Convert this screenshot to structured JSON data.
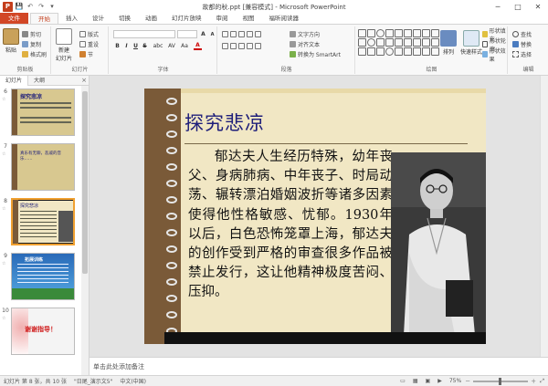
{
  "window": {
    "title": "故都的秋.ppt [兼容模式] - Microsoft PowerPoint",
    "logo_letter": "P",
    "minimize": "─",
    "maximize": "□",
    "close": "✕"
  },
  "quick_access": {
    "save": "💾",
    "undo": "↶",
    "redo": "↷",
    "more": "▾"
  },
  "tabs": [
    {
      "label": "文件"
    },
    {
      "label": "开始"
    },
    {
      "label": "插入"
    },
    {
      "label": "设计"
    },
    {
      "label": "切换"
    },
    {
      "label": "动画"
    },
    {
      "label": "幻灯片放映"
    },
    {
      "label": "审阅"
    },
    {
      "label": "视图"
    },
    {
      "label": "福昕阅读器"
    }
  ],
  "ribbon": {
    "clipboard": {
      "label": "剪贴板",
      "paste": "粘贴",
      "cut": "剪切",
      "copy": "复制",
      "format_painter": "格式刷"
    },
    "slides": {
      "label": "幻灯片",
      "new_slide": "新建",
      "new_slide_2": "幻灯片",
      "layout": "版式",
      "reset": "重设",
      "section": "节"
    },
    "font": {
      "label": "字体",
      "bold": "B",
      "italic": "I",
      "underline": "U",
      "strike": "S",
      "shadow": "abc",
      "spacing": "AV",
      "case": "Aa",
      "color": "A"
    },
    "paragraph": {
      "label": "段落",
      "text_direction": "文字方向",
      "align_text": "对齐文本",
      "smartart": "转换为 SmartArt"
    },
    "drawing": {
      "label": "绘图",
      "arrange": "排列",
      "quick_styles": "快速样式",
      "shape_fill": "形状填充",
      "shape_outline": "形状轮廓",
      "shape_effects": "形状效果"
    },
    "editing": {
      "label": "编辑",
      "find": "查找",
      "replace": "替换",
      "select": "选择"
    }
  },
  "left_panel": {
    "tab_slides": "幻灯片",
    "tab_outline": "大纲",
    "close": "×",
    "thumbnails": [
      {
        "num": "6",
        "title": "探究悲凉"
      },
      {
        "num": "7",
        "text": "真乐有无聊，悲戚的音乐……"
      },
      {
        "num": "8",
        "title": "探究悲凉"
      },
      {
        "num": "9",
        "title": "拓展训练"
      },
      {
        "num": "10",
        "title": "谢谢指导！"
      }
    ]
  },
  "slide": {
    "title": "探究悲凉",
    "body": "郁达夫人生经历特殊，幼年丧父、身病肺病、中年丧子、时局动荡、辗转漂泊婚姻波折等诸多因素使得他性格敏感、忧郁。1930年以后，白色恐怖笼罩上海，郁达夫的创作受到严格的审查很多作品被禁止发行，这让他精神极度苦闷、压抑。"
  },
  "notes": {
    "placeholder": "单击此处添加备注"
  },
  "statusbar": {
    "slide_info": "幻灯片 第 8 张，共 10 张",
    "theme": "\"日尾_演示文5\"",
    "language": "中文(中国)",
    "zoom": "75%",
    "zoom_minus": "－",
    "zoom_plus": "＋"
  },
  "colors": {
    "accent": "#c43e1c",
    "title_blue": "#1e1e7a",
    "paper": "#f1e7c4",
    "binding": "#7a5a38"
  }
}
